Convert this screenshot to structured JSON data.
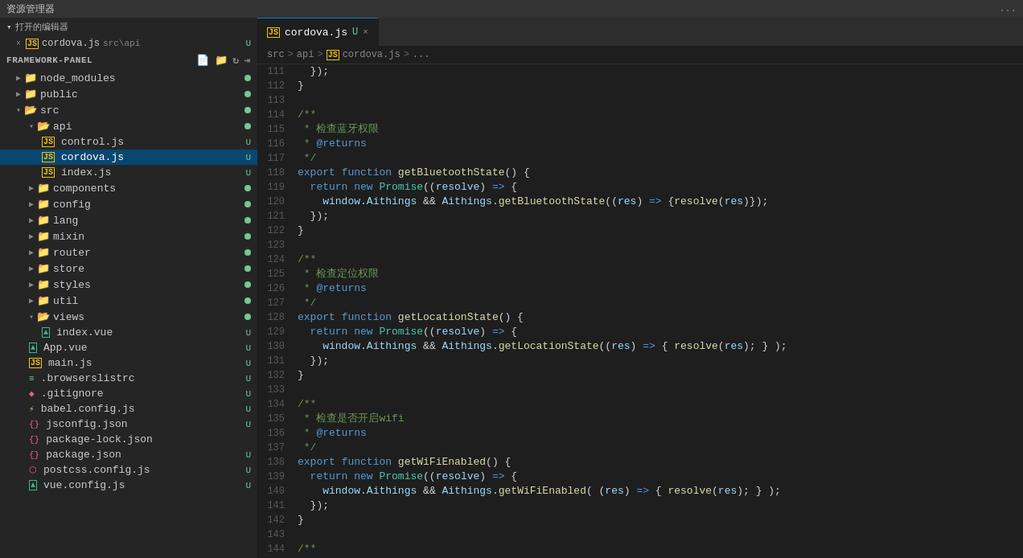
{
  "titleBar": {
    "title": "资源管理器",
    "moreBtn": "..."
  },
  "openEditors": {
    "label": "打开的编辑器",
    "items": [
      {
        "close": "×",
        "icon": "JS",
        "name": "cordova.js",
        "path": "src\\api",
        "badge": "U"
      }
    ]
  },
  "panel": {
    "name": "FRAMEWORK-PANEL",
    "icons": [
      "new-file",
      "new-folder",
      "refresh",
      "collapse"
    ]
  },
  "tree": {
    "items": [
      {
        "type": "folder",
        "indent": 1,
        "open": false,
        "name": "node_modules",
        "dot": true
      },
      {
        "type": "folder",
        "indent": 1,
        "open": false,
        "name": "public",
        "dot": true
      },
      {
        "type": "folder",
        "indent": 1,
        "open": true,
        "name": "src",
        "dot": true
      },
      {
        "type": "folder",
        "indent": 2,
        "open": true,
        "name": "api",
        "dot": true
      },
      {
        "type": "file",
        "indent": 3,
        "icon": "JS",
        "name": "control.js",
        "badge": "U"
      },
      {
        "type": "file",
        "indent": 3,
        "icon": "JS",
        "name": "cordova.js",
        "badge": "U",
        "active": true
      },
      {
        "type": "file",
        "indent": 3,
        "icon": "JS",
        "name": "index.js",
        "badge": "U"
      },
      {
        "type": "folder",
        "indent": 2,
        "open": false,
        "name": "components",
        "dot": true
      },
      {
        "type": "folder",
        "indent": 2,
        "open": false,
        "name": "config",
        "dot": true
      },
      {
        "type": "folder",
        "indent": 2,
        "open": false,
        "name": "lang",
        "dot": true
      },
      {
        "type": "folder",
        "indent": 2,
        "open": false,
        "name": "mixin",
        "dot": true
      },
      {
        "type": "folder",
        "indent": 2,
        "open": false,
        "name": "router",
        "dot": true
      },
      {
        "type": "folder",
        "indent": 2,
        "open": false,
        "name": "store",
        "dot": true
      },
      {
        "type": "folder",
        "indent": 2,
        "open": false,
        "name": "styles",
        "dot": true
      },
      {
        "type": "folder",
        "indent": 2,
        "open": false,
        "name": "util",
        "dot": true
      },
      {
        "type": "folder",
        "indent": 2,
        "open": true,
        "name": "views",
        "dot": true
      },
      {
        "type": "file",
        "indent": 3,
        "icon": "VUE",
        "name": "index.vue",
        "badge": "U"
      },
      {
        "type": "file",
        "indent": 2,
        "icon": "VUE",
        "name": "App.vue",
        "badge": "U"
      },
      {
        "type": "file",
        "indent": 2,
        "icon": "JS",
        "name": "main.js",
        "badge": "U"
      },
      {
        "type": "file",
        "indent": 2,
        "icon": "BROWSER",
        "name": ".browserslistrc",
        "badge": "U"
      },
      {
        "type": "file",
        "indent": 2,
        "icon": "GIT",
        "name": ".gitignore",
        "badge": "U"
      },
      {
        "type": "file",
        "indent": 2,
        "icon": "BABEL",
        "name": "babel.config.js",
        "badge": "U"
      },
      {
        "type": "file",
        "indent": 2,
        "icon": "JSON",
        "name": "jsconfig.json",
        "badge": "U"
      },
      {
        "type": "file",
        "indent": 2,
        "icon": "JSON",
        "name": "package-lock.json",
        "badge": ""
      },
      {
        "type": "file",
        "indent": 2,
        "icon": "JSON",
        "name": "package.json",
        "badge": "U"
      },
      {
        "type": "file",
        "indent": 2,
        "icon": "CSS",
        "name": "postcss.config.js",
        "badge": "U"
      },
      {
        "type": "file",
        "indent": 2,
        "icon": "VUE",
        "name": "vue.config.js",
        "badge": "U"
      }
    ]
  },
  "tabs": [
    {
      "icon": "JS",
      "name": "cordova.js",
      "modified": true,
      "close": "×",
      "active": true
    }
  ],
  "breadcrumb": {
    "items": [
      "src",
      ">",
      "api",
      ">",
      "JS cordova.js",
      ">",
      "..."
    ]
  },
  "code": {
    "lines": [
      {
        "num": 111,
        "html": "  <span class='punc'>});</span>"
      },
      {
        "num": 112,
        "html": "<span class='punc'>}</span>"
      },
      {
        "num": 113,
        "html": ""
      },
      {
        "num": 114,
        "html": "<span class='cmt'>/**</span>"
      },
      {
        "num": 115,
        "html": "<span class='cmt'> * 检查蓝牙权限</span>"
      },
      {
        "num": 116,
        "html": "<span class='cmt'> * <span class='cmt-special'>@returns</span></span>"
      },
      {
        "num": 117,
        "html": "<span class='cmt'> */</span>"
      },
      {
        "num": 118,
        "html": "<span class='kw'>export</span> <span class='kw'>function</span> <span class='fn'>getBluetoothState</span><span class='punc'>() {</span>"
      },
      {
        "num": 119,
        "html": "  <span class='kw'>return</span> <span class='kw'>new</span> <span class='cls'>Promise</span><span class='punc'>((</span><span class='param'>resolve</span><span class='punc'>)</span> <span class='arrow'>=></span> <span class='punc'>{</span>"
      },
      {
        "num": 120,
        "html": "    <span class='var'>window</span><span class='punc'>.</span><span class='prop'>Aithings</span> <span class='op'>&amp;&amp;</span> <span class='prop'>Aithings</span><span class='punc'>.</span><span class='fn'>getBluetoothState</span><span class='punc'>((</span><span class='param'>res</span><span class='punc'>)</span> <span class='arrow'>=></span> <span class='punc'>{</span><span class='fn'>resolve</span><span class='punc'>(</span><span class='var'>res</span><span class='punc'>)});</span>"
      },
      {
        "num": 121,
        "html": "  <span class='punc'>});</span>"
      },
      {
        "num": 122,
        "html": "<span class='punc'>}</span>"
      },
      {
        "num": 123,
        "html": ""
      },
      {
        "num": 124,
        "html": "<span class='cmt'>/**</span>"
      },
      {
        "num": 125,
        "html": "<span class='cmt'> * 检查定位权限</span>"
      },
      {
        "num": 126,
        "html": "<span class='cmt'> * <span class='cmt-special'>@returns</span></span>"
      },
      {
        "num": 127,
        "html": "<span class='cmt'> */</span>"
      },
      {
        "num": 128,
        "html": "<span class='kw'>export</span> <span class='kw'>function</span> <span class='fn'>getLocationState</span><span class='punc'>() {</span>"
      },
      {
        "num": 129,
        "html": "  <span class='kw'>return</span> <span class='kw'>new</span> <span class='cls'>Promise</span><span class='punc'>((</span><span class='param'>resolve</span><span class='punc'>)</span> <span class='arrow'>=></span> <span class='punc'>{</span>"
      },
      {
        "num": 130,
        "html": "    <span class='var'>window</span><span class='punc'>.</span><span class='prop'>Aithings</span> <span class='op'>&amp;&amp;</span> <span class='prop'>Aithings</span><span class='punc'>.</span><span class='fn'>getLocationState</span><span class='punc'>((</span><span class='param'>res</span><span class='punc'>)</span> <span class='arrow'>=></span> <span class='punc'>{ </span><span class='fn'>resolve</span><span class='punc'>(</span><span class='var'>res</span><span class='punc'>); } );</span>"
      },
      {
        "num": 131,
        "html": "  <span class='punc'>});</span>"
      },
      {
        "num": 132,
        "html": "<span class='punc'>}</span>"
      },
      {
        "num": 133,
        "html": ""
      },
      {
        "num": 134,
        "html": "<span class='cmt'>/**</span>"
      },
      {
        "num": 135,
        "html": "<span class='cmt'> * 检查是否开启wifi</span>"
      },
      {
        "num": 136,
        "html": "<span class='cmt'> * <span class='cmt-special'>@returns</span></span>"
      },
      {
        "num": 137,
        "html": "<span class='cmt'> */</span>"
      },
      {
        "num": 138,
        "html": "<span class='kw'>export</span> <span class='kw'>function</span> <span class='fn'>getWiFiEnabled</span><span class='punc'>() {</span>"
      },
      {
        "num": 139,
        "html": "  <span class='kw'>return</span> <span class='kw'>new</span> <span class='cls'>Promise</span><span class='punc'>((</span><span class='param'>resolve</span><span class='punc'>)</span> <span class='arrow'>=></span> <span class='punc'>{</span>"
      },
      {
        "num": 140,
        "html": "    <span class='var'>window</span><span class='punc'>.</span><span class='prop'>Aithings</span> <span class='op'>&amp;&amp;</span> <span class='prop'>Aithings</span><span class='punc'>.</span><span class='fn'>getWiFiEnabled</span><span class='punc'>( (</span><span class='param'>res</span><span class='punc'>)</span> <span class='arrow'>=></span> <span class='punc'>{ </span><span class='fn'>resolve</span><span class='punc'>(</span><span class='var'>res</span><span class='punc'>); } );</span>"
      },
      {
        "num": 141,
        "html": "  <span class='punc'>});</span>"
      },
      {
        "num": 142,
        "html": "<span class='punc'>}</span>"
      },
      {
        "num": 143,
        "html": ""
      },
      {
        "num": 144,
        "html": "<span class='cmt'>/**</span>"
      }
    ]
  }
}
